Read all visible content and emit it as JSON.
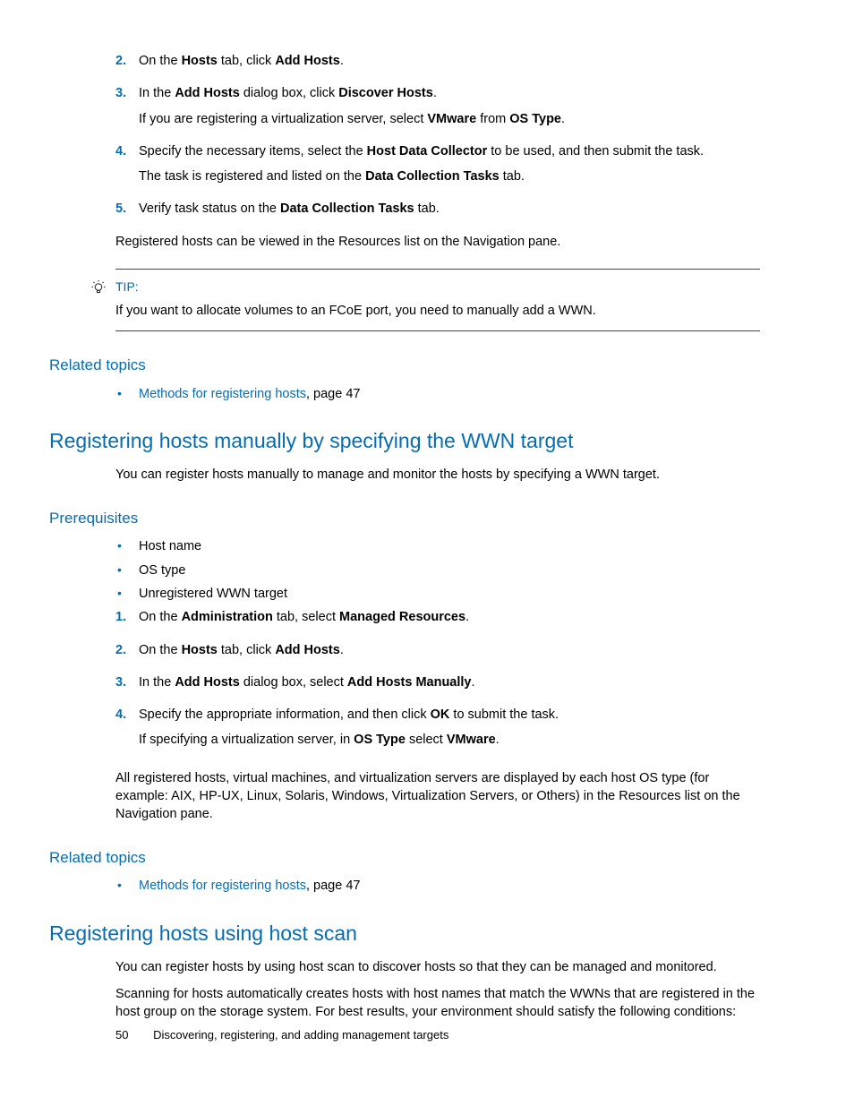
{
  "steps1": [
    {
      "num": "2.",
      "html": "On the <strong>Hosts</strong> tab, click <strong>Add Hosts</strong>."
    },
    {
      "num": "3.",
      "html": "In the <strong>Add Hosts</strong> dialog box, click <strong>Discover Hosts</strong>.",
      "sub": "If you are registering a virtualization server, select <strong>VMware</strong> from <strong>OS Type</strong>."
    },
    {
      "num": "4.",
      "html": "Specify the necessary items, select the <strong>Host Data Collector</strong> to be used, and then submit the task.",
      "sub": "The task is registered and listed on the <strong>Data Collection Tasks</strong> tab."
    },
    {
      "num": "5.",
      "html": "Verify task status on the <strong>Data Collection Tasks</strong> tab."
    }
  ],
  "afterSteps1": "Registered hosts can be viewed in the Resources list on the Navigation pane.",
  "tip": {
    "label": "TIP:",
    "text": "If you want to allocate volumes to an FCoE port, you need to manually add a WWN."
  },
  "related1": {
    "heading": "Related topics",
    "link": "Methods for registering hosts",
    "suffix": ", page 47"
  },
  "section2": {
    "heading": "Registering hosts manually by specifying the WWN target",
    "intro": "You can register hosts manually to manage and monitor the hosts by specifying a WWN target."
  },
  "prereq": {
    "heading": "Prerequisites",
    "bullets": [
      "Host name",
      "OS type",
      "Unregistered WWN target"
    ]
  },
  "steps2": [
    {
      "num": "1.",
      "html": "On the <strong>Administration</strong> tab, select <strong>Managed Resources</strong>."
    },
    {
      "num": "2.",
      "html": "On the <strong>Hosts</strong> tab, click <strong>Add Hosts</strong>."
    },
    {
      "num": "3.",
      "html": "In the <strong>Add Hosts</strong> dialog box, select <strong>Add Hosts Manually</strong>."
    },
    {
      "num": "4.",
      "html": "Specify the appropriate information, and then click <strong>OK</strong> to submit the task.",
      "sub": "If specifying a virtualization server, in <strong>OS Type</strong> select <strong>VMware</strong>."
    }
  ],
  "afterSteps2": "All registered hosts, virtual machines, and virtualization servers are displayed by each host OS type (for example: AIX, HP-UX, Linux, Solaris, Windows, Virtualization Servers, or Others) in the Resources list on the Navigation pane.",
  "related2": {
    "heading": "Related topics",
    "link": "Methods for registering hosts",
    "suffix": ", page 47"
  },
  "section3": {
    "heading": "Registering hosts using host scan",
    "p1": "You can register hosts by using host scan to discover hosts so that they can be managed and monitored.",
    "p2": "Scanning for hosts automatically creates hosts with host names that match the WWNs that are registered in the host group on the storage system. For best results, your environment should satisfy the following conditions:"
  },
  "footer": {
    "page": "50",
    "title": "Discovering, registering, and adding management targets"
  }
}
